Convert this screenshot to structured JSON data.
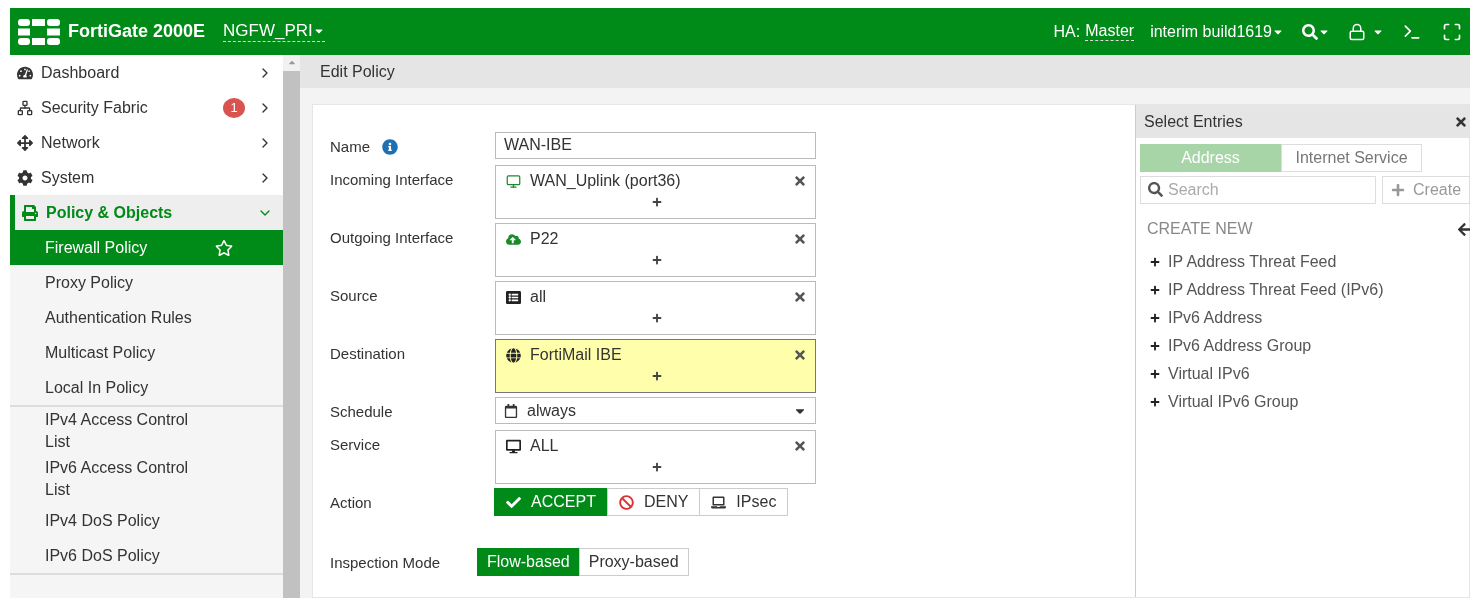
{
  "header": {
    "product": "FortiGate 2000E",
    "vdom": "NGFW_PRI",
    "ha_label": "HA:",
    "ha_role": "Master",
    "build": "interim build1619"
  },
  "sidebar": {
    "items": [
      {
        "label": "Dashboard",
        "expanded": false
      },
      {
        "label": "Security Fabric",
        "badge": "1",
        "expanded": false
      },
      {
        "label": "Network",
        "expanded": false
      },
      {
        "label": "System",
        "expanded": false
      },
      {
        "label": "Policy & Objects",
        "expanded": true,
        "groups": [
          {
            "items": [
              {
                "label": "Firewall Policy",
                "selected": true
              },
              {
                "label": "Proxy Policy",
                "selected": false
              },
              {
                "label": "Authentication Rules",
                "selected": false
              },
              {
                "label": "Multicast Policy",
                "selected": false
              },
              {
                "label": "Local In Policy",
                "selected": false
              }
            ]
          },
          {
            "items": [
              {
                "label": "IPv4 Access Control List",
                "selected": false
              },
              {
                "label": "IPv6 Access Control List",
                "selected": false
              },
              {
                "label": "IPv4 DoS Policy",
                "selected": false
              },
              {
                "label": "IPv6 DoS Policy",
                "selected": false
              }
            ]
          }
        ]
      }
    ]
  },
  "page_title": "Edit Policy",
  "form": {
    "fields": [
      {
        "kind": "text",
        "label": "Name",
        "info": true,
        "value": "WAN-IBE"
      },
      {
        "kind": "multi",
        "label": "Incoming Interface",
        "entries": [
          "WAN_Uplink (port36)"
        ],
        "highlighted": false
      },
      {
        "kind": "multi",
        "label": "Outgoing Interface",
        "entries": [
          "P22"
        ],
        "highlighted": false
      },
      {
        "kind": "multi",
        "label": "Source",
        "entries": [
          "all"
        ],
        "highlighted": false
      },
      {
        "kind": "multi",
        "label": "Destination",
        "entries": [
          "FortiMail IBE"
        ],
        "highlighted": true
      },
      {
        "kind": "select",
        "label": "Schedule",
        "value": "always"
      },
      {
        "kind": "multi",
        "label": "Service",
        "entries": [
          "ALL"
        ],
        "highlighted": false
      },
      {
        "kind": "choice",
        "label": "Action",
        "options": [
          {
            "label": "ACCEPT",
            "selected": true
          },
          {
            "label": "DENY",
            "selected": false
          },
          {
            "label": "IPsec",
            "selected": false
          }
        ]
      },
      {
        "kind": "choice",
        "label": "Inspection Mode",
        "options": [
          {
            "label": "Flow-based",
            "selected": true
          },
          {
            "label": "Proxy-based",
            "selected": false
          }
        ]
      }
    ]
  },
  "panel": {
    "title": "Select Entries",
    "tabs": [
      {
        "label": "Address",
        "selected": true
      },
      {
        "label": "Internet Service",
        "selected": false
      }
    ],
    "search": {
      "placeholder": "Search"
    },
    "create_button": "Create",
    "section": "CREATE NEW",
    "items": [
      "IP Address Threat Feed",
      "IP Address Threat Feed (IPv6)",
      "IPv6 Address",
      "IPv6 Address Group",
      "Virtual IPv6",
      "Virtual IPv6 Group"
    ]
  }
}
